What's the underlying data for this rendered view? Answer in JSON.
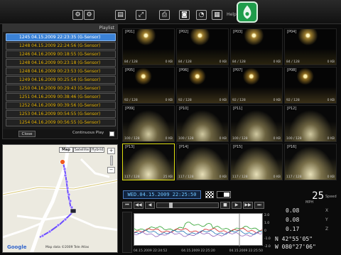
{
  "toolbar": {
    "help_label": "Help",
    "icons": [
      "gear-icon",
      "save-icon",
      "print-icon",
      "snapshot-icon",
      "zoom-icon",
      "speed-icon",
      "map-icon",
      "help-icon"
    ]
  },
  "playlist": {
    "title": "Playlist",
    "items": [
      "1245 04.15.2009 22:23:35 (G-Sensor)",
      "1248 04.15.2009 22:24:56 (G-Sensor)",
      "1246 04.16.2009 00:18:55 (G-Sensor)",
      "1248 04.16.2009 00:23:18 (G-Sensor)",
      "1248 04.16.2009 00:23:53 (G-Sensor)",
      "1249 04.16.2009 00:25:54 (G-Sensor)",
      "1250 04.16.2009 00:29:43 (G-Sensor)",
      "1251 04.16.2009 00:38:46 (G-Sensor)",
      "1252 04.16.2009 00:39:56 (G-Sensor)",
      "1253 04.16.2009 00:54:55 (G-Sensor)",
      "1254 04.16.2009 00:56:55 (G-Sensor)"
    ],
    "close_label": "Close",
    "continuous_label": "Continuous Play"
  },
  "map": {
    "types": [
      "Map",
      "Satellite",
      "Hybrid"
    ],
    "zoom_in": "+",
    "zoom_out": "−",
    "brand": "Google",
    "data_text": "Map data ©2009 Tele Atlas",
    "route_color": "#6a4cff"
  },
  "video_grid": {
    "cells": [
      {
        "tag": "[P01]",
        "left": "84 / 128",
        "right": "0 KB"
      },
      {
        "tag": "[P02]",
        "left": "84 / 128",
        "right": "0 KB"
      },
      {
        "tag": "[P03]",
        "left": "84 / 128",
        "right": "0 KB"
      },
      {
        "tag": "[P04]",
        "left": "84 / 128",
        "right": "0 KB"
      },
      {
        "tag": "[P05]",
        "left": "92 / 128",
        "right": "0 KB"
      },
      {
        "tag": "[P06]",
        "left": "92 / 128",
        "right": "0 KB"
      },
      {
        "tag": "[P07]",
        "left": "92 / 128",
        "right": "0 KB"
      },
      {
        "tag": "[P08]",
        "left": "92 / 128",
        "right": "0 KB"
      },
      {
        "tag": "[P09]",
        "left": "100 / 128",
        "right": "0 KB"
      },
      {
        "tag": "[P10]",
        "left": "100 / 128",
        "right": "0 KB"
      },
      {
        "tag": "[P11]",
        "left": "100 / 128",
        "right": "0 KB"
      },
      {
        "tag": "[P12]",
        "left": "100 / 128",
        "right": "0 KB"
      },
      {
        "tag": "[P13]",
        "left": "117 / 128",
        "right": "25 KB"
      },
      {
        "tag": "[P14]",
        "left": "117 / 128",
        "right": "0 KB"
      },
      {
        "tag": "[P15]",
        "left": "117 / 128",
        "right": "0 KB"
      },
      {
        "tag": "[P16]",
        "left": "117 / 128",
        "right": "0 KB"
      }
    ]
  },
  "player": {
    "timestamp": "WED.04.15.2009 22:25:50",
    "controls": [
      "⏮",
      "◀◀",
      "◀",
      "■",
      "▶",
      "▶▶",
      "⏭"
    ]
  },
  "graph": {
    "axis_ticks": [
      "2.0",
      "1.0",
      "0",
      "-1.0",
      "-2.0"
    ],
    "time_ticks": [
      "04.15.2009 22:24:52",
      "04.15.2009 22:25:20",
      "04.15.2009 22:25:50"
    ],
    "series_colors": [
      "#2ca02c",
      "#d62728",
      "#1f77b4",
      "#9467bd"
    ]
  },
  "telemetry": {
    "speed_label": "Speed",
    "speed_value": "25",
    "speed_unit": "MPH",
    "g_x": "0.08",
    "g_y": "0.08",
    "g_z": "0.17",
    "axis_x": "X",
    "axis_y": "Y",
    "axis_z": "Z",
    "lat": "N 42°55'05\"",
    "lon": "W 080°27'06\""
  }
}
